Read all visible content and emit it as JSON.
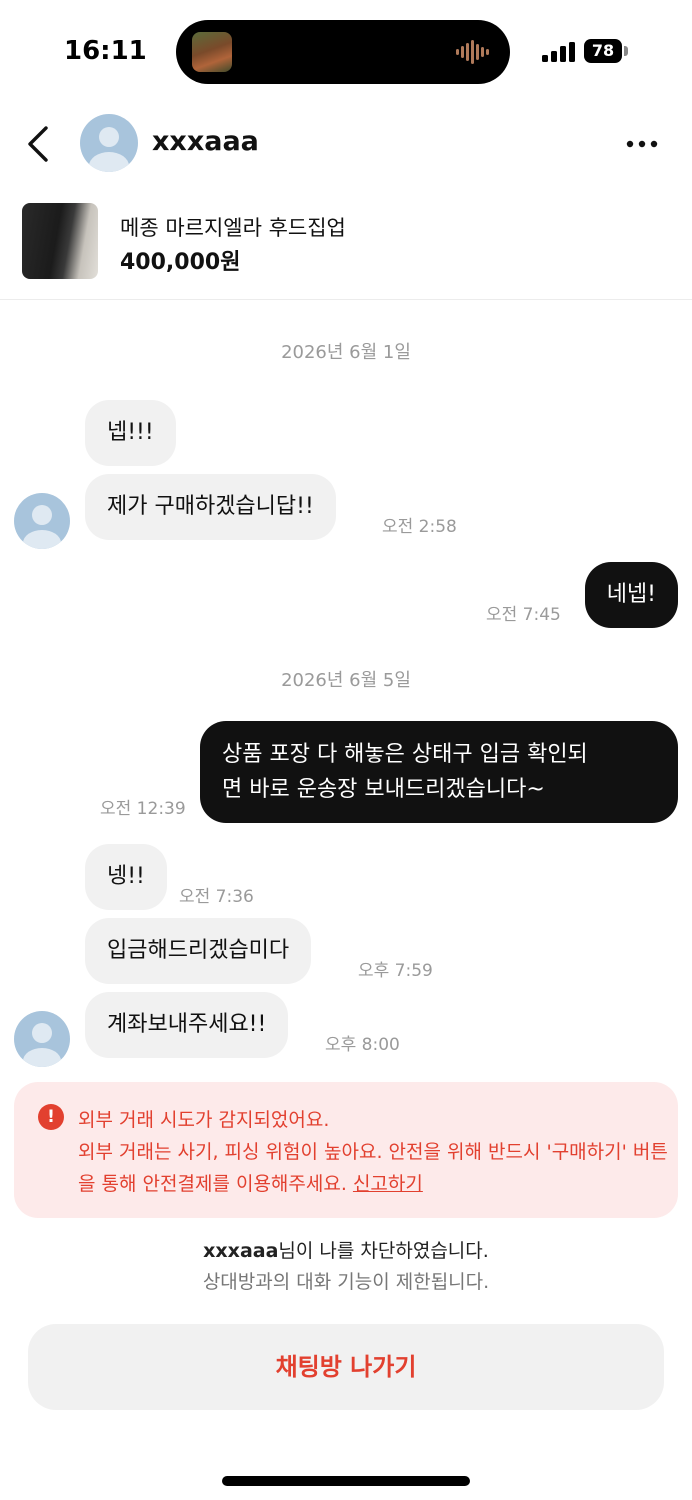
{
  "status_bar": {
    "time": "16:11",
    "battery": "78"
  },
  "header": {
    "name": "xxxaaa"
  },
  "product": {
    "name": "메종 마르지엘라 후드집업",
    "price": "400,000원"
  },
  "chat": {
    "dates": [
      "2026년 6월 1일",
      "2026년 6월 5일"
    ],
    "messages": [
      {
        "side": "in",
        "text": "넵!!!",
        "time": ""
      },
      {
        "side": "in",
        "text": "제가 구매하겠습니답!!",
        "time": "오전 2:58"
      },
      {
        "side": "out",
        "text": "네넵!",
        "time": "오전 7:45"
      },
      {
        "side": "out",
        "text_lines": [
          "상품 포장 다 해놓은 상태구 입금 확인되",
          "면 바로 운송장 보내드리겠습니다~"
        ],
        "time": "오전 12:39"
      },
      {
        "side": "in",
        "text": "넹!!",
        "time": "오전 7:36"
      },
      {
        "side": "in",
        "text": "입금해드리겠습미다",
        "time": "오후 7:59"
      },
      {
        "side": "in",
        "text": "계좌보내주세요!!",
        "time": "오후 8:00"
      }
    ]
  },
  "warning": {
    "title": "외부 거래 시도가 감지되었어요.",
    "body": "외부 거래는 사기, 피싱 위험이 높아요. 안전을 위해 반드시 '구매하기' 버튼을 통해 안전결제를 이용해주세요.",
    "report_link": "신고하기",
    "icon": "!"
  },
  "blocked": {
    "name": "xxxaaa",
    "line_suffix": "님이 나를 차단하였습니다.",
    "sub": "상대방과의 대화 기능이 제한됩니다."
  },
  "leave_button": "채팅방 나가기",
  "colors": {
    "accent_red": "#e2402f",
    "warning_bg": "#fdeaea",
    "bubble_in": "#f1f1f1",
    "bubble_out": "#111111",
    "avatar": "#a8c4dc"
  }
}
